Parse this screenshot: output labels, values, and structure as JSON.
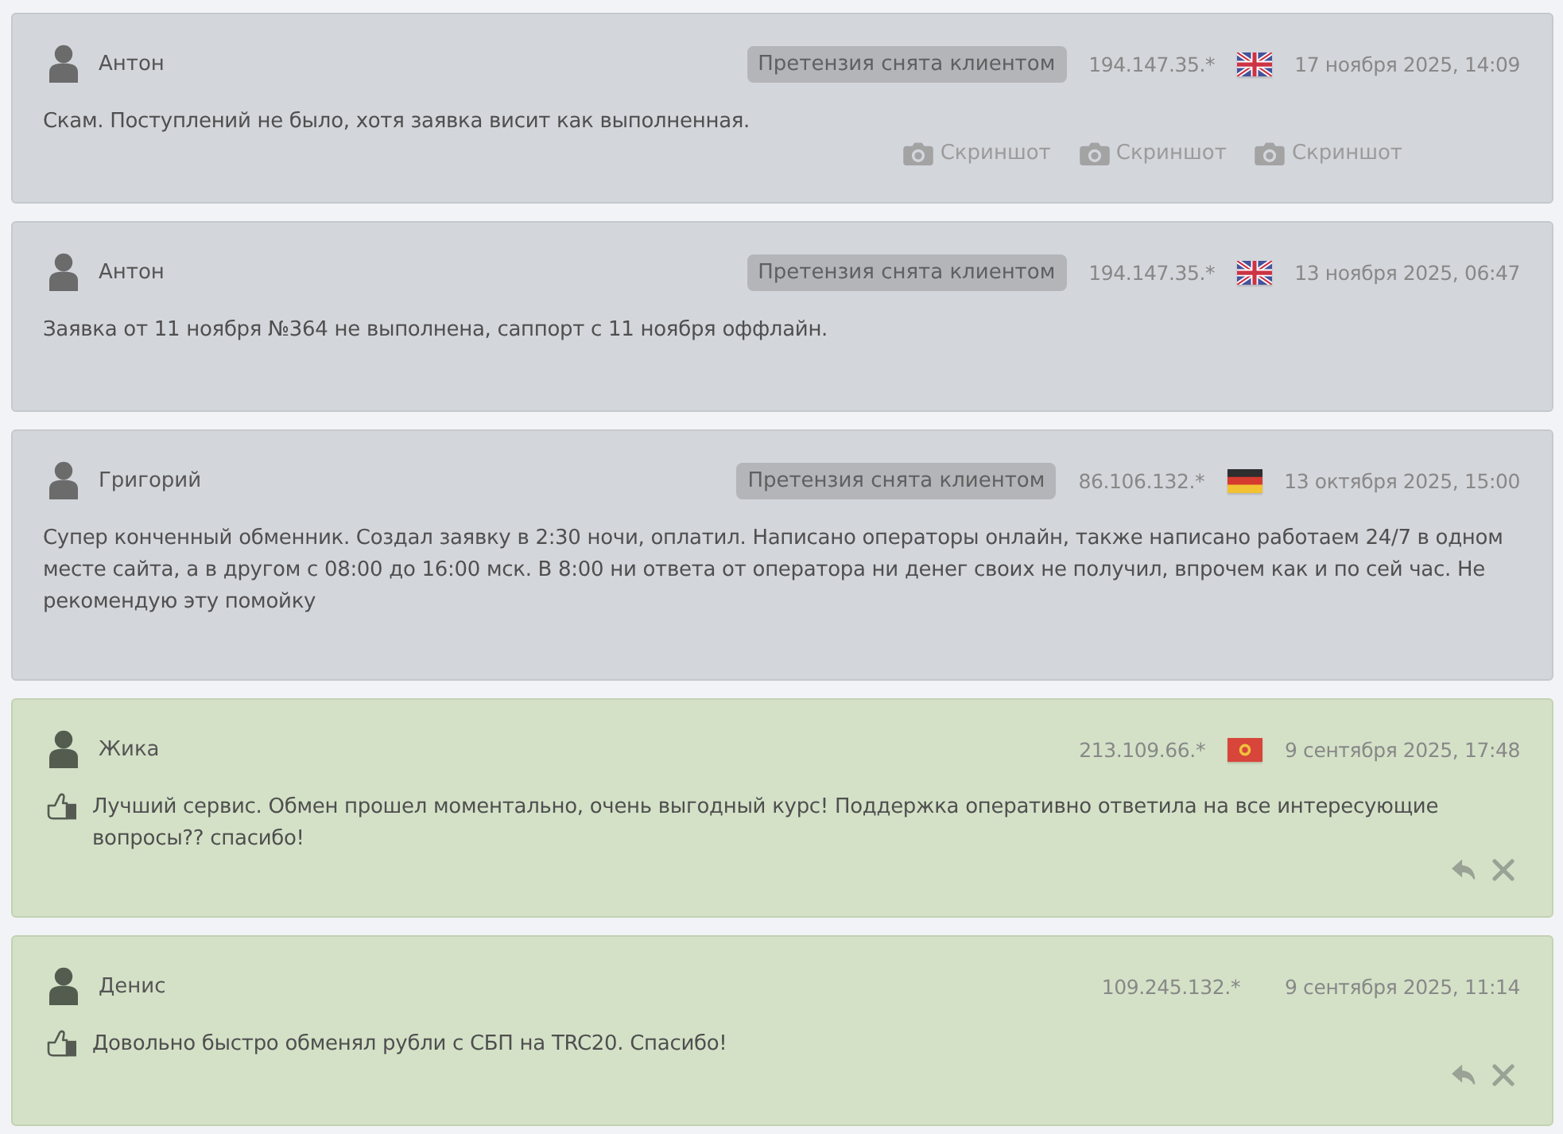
{
  "reviews": [
    {
      "kind": "claim",
      "author": "Антон",
      "badge": "Претензия снята клиентом",
      "ip": "194.147.35.*",
      "flag": {
        "kind": "gb"
      },
      "date": "17 ноября 2025, 14:09",
      "text": "Скам. Поступлений не было, хотя заявка висит как выполненная.",
      "attachments": [
        {
          "label": "Скриншот"
        },
        {
          "label": "Скриншот"
        },
        {
          "label": "Скриншот"
        }
      ]
    },
    {
      "kind": "claim",
      "author": "Антон",
      "badge": "Претензия снята клиентом",
      "ip": "194.147.35.*",
      "flag": {
        "kind": "gb"
      },
      "date": "13 ноября 2025, 06:47",
      "text": "Заявка от 11 ноября №364 не выполнена, саппорт с 11 ноября оффлайн."
    },
    {
      "kind": "claim",
      "author": "Григорий",
      "badge": "Претензия снята клиентом",
      "ip": "86.106.132.*",
      "flag": {
        "kind": "de"
      },
      "date": "13 октября 2025, 15:00",
      "text": "Супер конченный обменник. Создал заявку в 2:30 ночи, оплатил. Написано операторы онлайн, также написано работаем 24/7 в одном месте сайта, а в другом с 08:00 до 16:00 мск. В 8:00 ни ответа от оператора ни денег своих не получил, впрочем как и по сей час. Не рекомендую эту помойку"
    },
    {
      "kind": "positive",
      "author": "Жика",
      "ip": "213.109.66.*",
      "flag": {
        "kind": "kg"
      },
      "date": "9 сентября 2025, 17:48",
      "text": "Лучший сервис. Обмен прошел моментально, очень выгодный курс! Поддержка оперативно ответила на все интересующие вопросы?? спасибо!"
    },
    {
      "kind": "positive",
      "author": "Денис",
      "ip": "109.245.132.*",
      "date": "9 сентября 2025, 11:14",
      "text": "Довольно быстро обменял рубли с СБП на TRC20. Спасибо!"
    }
  ]
}
